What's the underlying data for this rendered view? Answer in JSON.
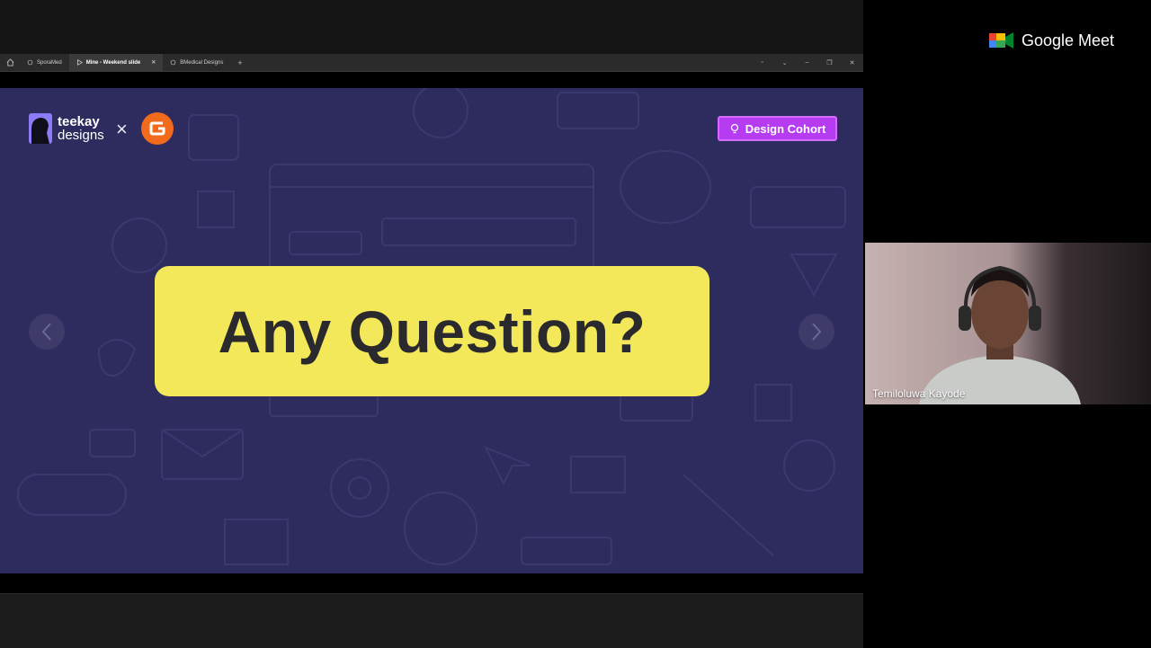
{
  "browser": {
    "tabs": [
      {
        "label": "SporaMed",
        "active": false
      },
      {
        "label": "Mine - Weekend slide",
        "active": true
      },
      {
        "label": "BMedical Designs",
        "active": false
      }
    ],
    "new_tab_label": "+"
  },
  "slide": {
    "logo_line1": "teekay",
    "logo_line2": "designs",
    "times_sign": "×",
    "cohort_label": "Design Cohort",
    "question": "Any Question?",
    "prev_icon": "chevron-left-icon",
    "next_icon": "chevron-right-icon"
  },
  "meet": {
    "brand": "Google Meet",
    "participant_name": "Temiloluwa Kayode"
  },
  "colors": {
    "slide_bg": "#2e2b5e",
    "card_yellow": "#f2e85a",
    "cohort_purple": "#b53cf0",
    "partner_orange": "#f26a1b"
  }
}
